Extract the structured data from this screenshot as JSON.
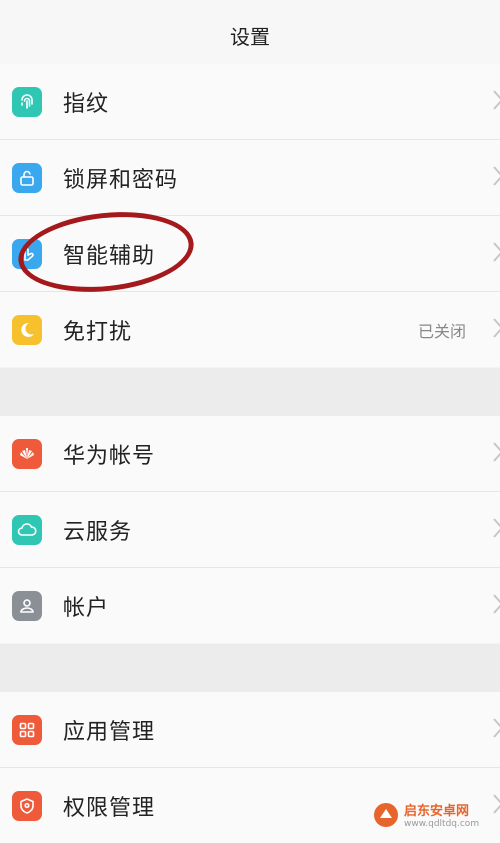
{
  "header": {
    "title": "设置"
  },
  "group1": [
    {
      "label": "指纹",
      "icon": "fingerprint-icon",
      "color": "#2fc6b4"
    },
    {
      "label": "锁屏和密码",
      "icon": "lock-icon",
      "color": "#3aa8ef"
    },
    {
      "label": "智能辅助",
      "icon": "hand-icon",
      "color": "#3aa8ef"
    },
    {
      "label": "免打扰",
      "icon": "moon-icon",
      "color": "#f6c12d",
      "value": "已关闭"
    }
  ],
  "group2": [
    {
      "label": "华为帐号",
      "icon": "huawei-logo-icon",
      "color": "#ef5a3a"
    },
    {
      "label": "云服务",
      "icon": "cloud-icon",
      "color": "#2fc6b4"
    },
    {
      "label": "帐户",
      "icon": "person-icon",
      "color": "#8b8f96"
    }
  ],
  "group3": [
    {
      "label": "应用管理",
      "icon": "apps-grid-icon",
      "color": "#ef5a3a"
    },
    {
      "label": "权限管理",
      "icon": "shield-icon",
      "color": "#ef5a3a"
    }
  ],
  "watermark": {
    "cn": "启东安卓网",
    "url": "www.qdltdq.com"
  },
  "colors": {
    "annotation": "#a3191c",
    "chevron": "#c6c6c6"
  }
}
